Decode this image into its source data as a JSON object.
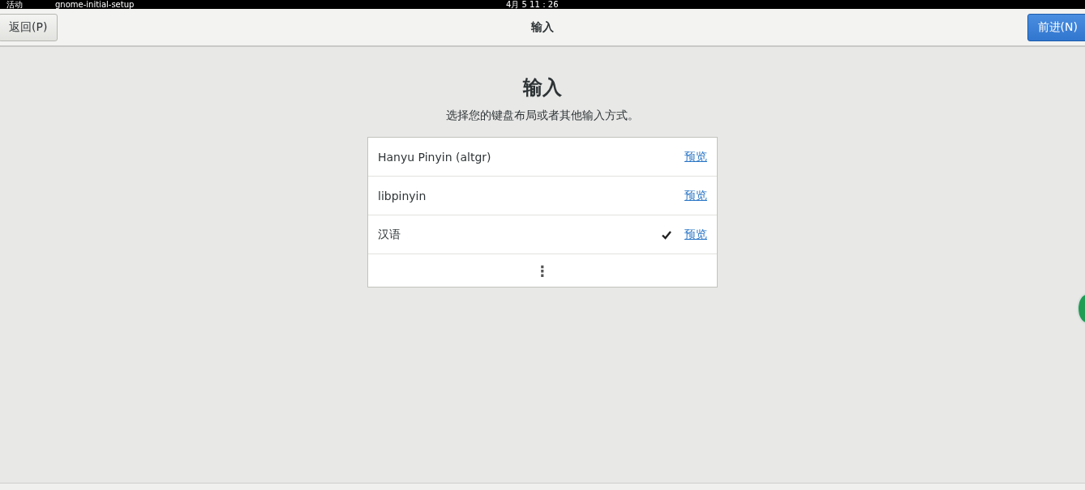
{
  "top_bar": {
    "activities": "活动",
    "app_name": "gnome-initial-setup",
    "clock": "4月 5 11：26"
  },
  "header": {
    "back_button": "返回(P)",
    "title": "输入",
    "next_button": "前进(N)"
  },
  "page": {
    "heading": "输入",
    "subtitle": "选择您的键盘布局或者其他输入方式。"
  },
  "input_sources": [
    {
      "name": "Hanyu Pinyin (altgr)",
      "selected": false,
      "preview": "预览"
    },
    {
      "name": "libpinyin",
      "selected": false,
      "preview": "预览"
    },
    {
      "name": "汉语",
      "selected": true,
      "preview": "预览"
    }
  ],
  "more_button": "⋮"
}
